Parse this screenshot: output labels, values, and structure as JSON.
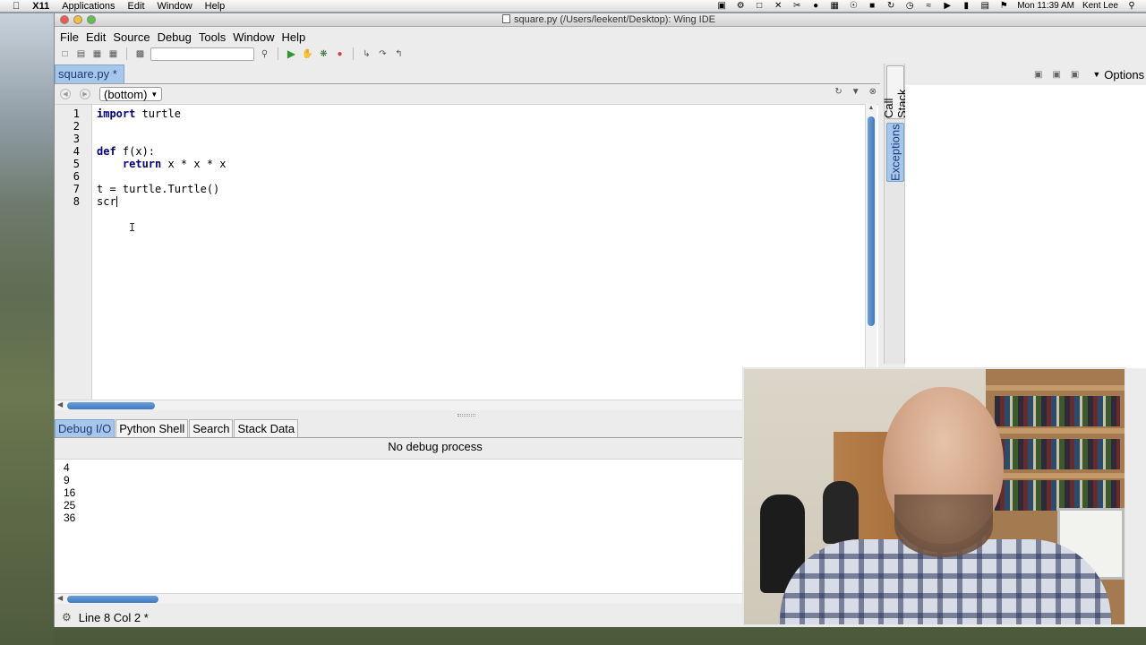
{
  "mac_menubar": {
    "items": [
      "X11",
      "Applications",
      "Edit",
      "Window",
      "Help"
    ],
    "clock": "Mon 11:39 AM",
    "user": "Kent Lee"
  },
  "window": {
    "title": "square.py (/Users/leekent/Desktop): Wing IDE"
  },
  "menubar": {
    "items": [
      "File",
      "Edit",
      "Source",
      "Debug",
      "Tools",
      "Window",
      "Help"
    ]
  },
  "editor": {
    "tab_label": "square.py *",
    "scope": "(bottom)",
    "lines": [
      {
        "n": "1",
        "kw": "import",
        "rest": " turtle"
      },
      {
        "n": "2",
        "kw": "",
        "rest": ""
      },
      {
        "n": "3",
        "kw": "",
        "rest": ""
      },
      {
        "n": "4",
        "kw": "def",
        "rest": " f(x):"
      },
      {
        "n": "5",
        "kw": "    return",
        "rest": " x * x * x"
      },
      {
        "n": "6",
        "kw": "",
        "rest": ""
      },
      {
        "n": "7",
        "kw": "",
        "rest": "t = turtle.Turtle()"
      },
      {
        "n": "8",
        "kw": "",
        "rest": "scr"
      }
    ]
  },
  "bottom_panel": {
    "tabs": [
      "Debug I/O",
      "Python Shell",
      "Search",
      "Stack Data"
    ],
    "active_tab": "Debug I/O",
    "status": "No debug process",
    "output": [
      "4",
      "9",
      "16",
      "25",
      "36"
    ]
  },
  "statusbar": {
    "text": "Line 8 Col 2 *"
  },
  "side_panel": {
    "tabs": [
      "Call Stack",
      "Exceptions"
    ],
    "active_tab": "Exceptions",
    "options_label": "Options"
  },
  "colors": {
    "tab_active_bg": "#a7c7ea",
    "scroll_thumb": "#3f79c2",
    "keyword": "#000080"
  }
}
